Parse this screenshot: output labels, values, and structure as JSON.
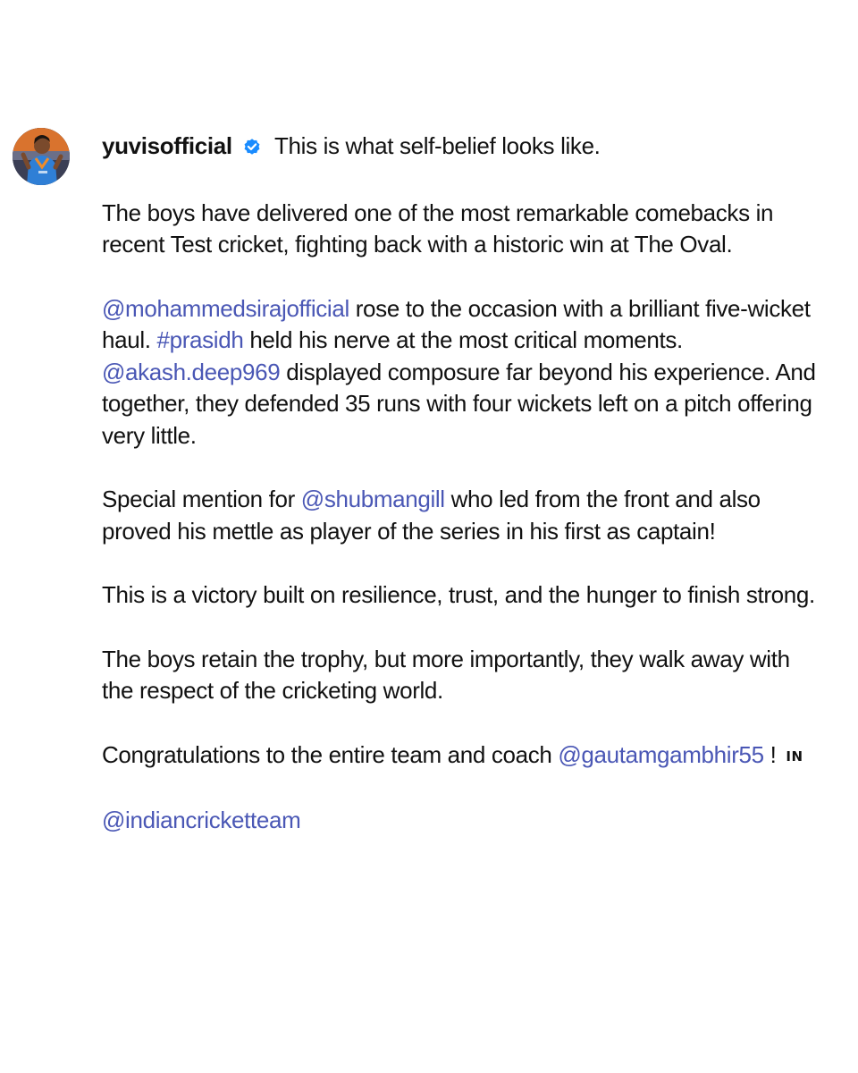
{
  "post": {
    "author": {
      "username": "yuvisofficial",
      "avatar_icon": "profile-photo",
      "verified_icon": "verified-badge-icon",
      "verified_color": "#1a8cff"
    },
    "caption": {
      "intro": "This is what self-belief looks like.",
      "para1": "The boys have delivered one of the most remarkable comebacks in recent Test cricket, fighting back with a historic win at The Oval.",
      "para2": {
        "mention_siraj": "@mohammedsirajofficial",
        "text_a": " rose to the occasion with a brilliant five-wicket haul. ",
        "hashtag_prasidh": "#prasidh",
        "text_b": " held his nerve at the most critical moments. ",
        "mention_akash": "@akash.deep969",
        "text_c": " displayed composure far beyond his experience. And together, they defended 35 runs with four wickets left on a pitch offering very little."
      },
      "para3": {
        "text_a": "Special mention for ",
        "mention_gill": "@shubmangill",
        "text_b": " who led from the front and also proved his mettle as player of the series in his first as captain!"
      },
      "para4": "This is a victory built on resilience, trust, and the hunger to finish strong.",
      "para5": "The boys retain the trophy, but more importantly, they walk away with the respect of the cricketing world.",
      "para6": {
        "text_a": "Congratulations to the entire team and coach ",
        "mention_gambhir": "@gautamgambhir55",
        "text_b": " ! ",
        "flag": "IN"
      },
      "para7": {
        "mention_team": "@indiancricketteam"
      }
    },
    "link_color": "#4a57b5"
  }
}
